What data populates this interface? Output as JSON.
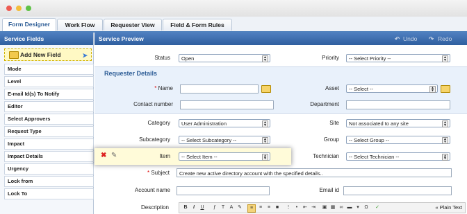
{
  "tabs": [
    {
      "label": "Form Designer"
    },
    {
      "label": "Work Flow"
    },
    {
      "label": "Requester View"
    },
    {
      "label": "Field & Form Rules"
    }
  ],
  "sidebar": {
    "title": "Service Fields",
    "add_label": "Add New Field",
    "items": [
      "Mode",
      "Level",
      "E-mail Id(s) To Notify",
      "Editor",
      "Select Approvers",
      "Request Type",
      "Impact",
      "Impact Details",
      "Urgency",
      "Lock from",
      "Lock To"
    ]
  },
  "preview": {
    "title": "Service Preview",
    "undo_label": "Undo",
    "redo_label": "Redo"
  },
  "form": {
    "status_label": "Status",
    "status_value": "Open",
    "priority_label": "Priority",
    "priority_value": "-- Select Priority --",
    "section_title": "Requester Details",
    "name_label": "Name",
    "name_req": "*",
    "asset_label": "Asset",
    "asset_value": "-- Select --",
    "contact_label": "Contact number",
    "department_label": "Department",
    "category_label": "Category",
    "category_value": "User Administration",
    "site_label": "Site",
    "site_value": "Not associated to any site",
    "subcategory_label": "Subcategory",
    "subcategory_value": "-- Select Subcategory --",
    "group_label": "Group",
    "group_value": "-- Select Group --",
    "item_label": "Item",
    "item_value": "-- Select Item --",
    "technician_label": "Technician",
    "technician_value": "-- Select Technician --",
    "subject_label": "Subject",
    "subject_req": "*",
    "subject_value": "Create new active directory account with the specified details..",
    "account_label": "Account name",
    "emailid_label": "Email id",
    "description_label": "Description",
    "plain_text_label": "« Plain Text"
  },
  "colors": {
    "accent": "#2f5f9f",
    "highlight": "#fffbd9",
    "required": "#dd0000"
  }
}
